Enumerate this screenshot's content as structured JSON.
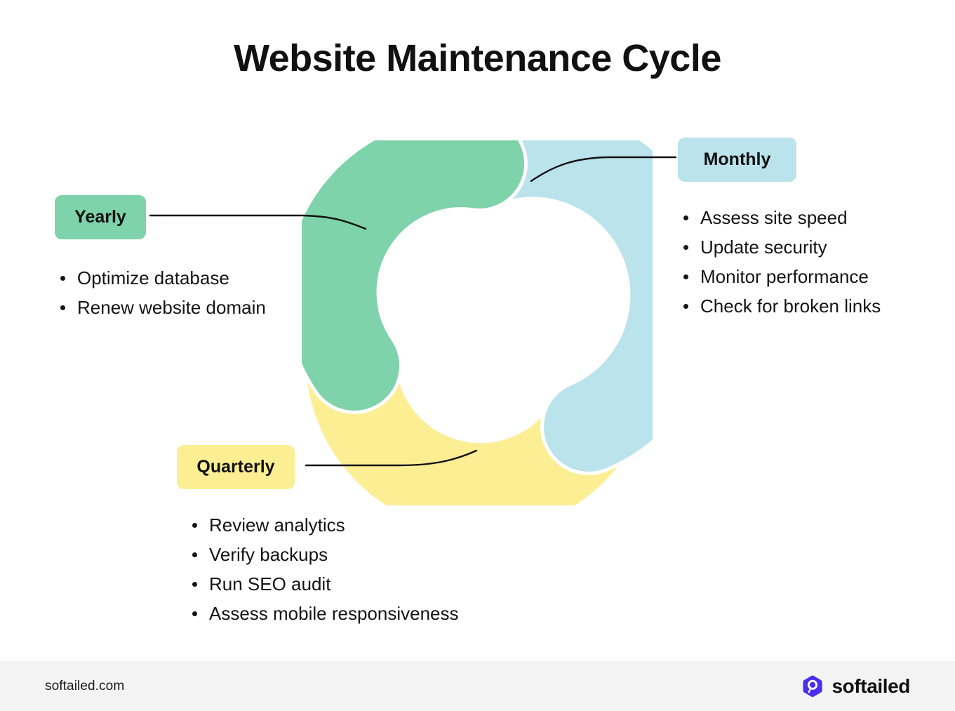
{
  "page": {
    "title": "Website Maintenance Cycle",
    "background": "#FFFFFF"
  },
  "colors": {
    "monthly": "#BBE3EC",
    "yearly": "#7ED3AA",
    "quarterly": "#FCEE93",
    "text": "#141414",
    "connector": "#111111",
    "footer_bg": "#F3F3F3",
    "brand_purple": "#4B2EF0"
  },
  "chart_data": {
    "type": "pie",
    "variant": "donut",
    "title": "Website Maintenance Cycle",
    "legend_position": "callout-labels",
    "grid": false,
    "categories": [
      "Monthly",
      "Quarterly",
      "Yearly"
    ],
    "values": [
      33.34,
      33.33,
      33.33
    ],
    "slice_colors": [
      "#BBE3EC",
      "#FCEE93",
      "#7ED3AA"
    ],
    "segments": [
      {
        "label": "Monthly",
        "color": "#BBE3EC",
        "start_angle_deg": 0,
        "end_angle_deg": 120,
        "value": 33.34
      },
      {
        "label": "Quarterly",
        "color": "#FCEE93",
        "start_angle_deg": 120,
        "end_angle_deg": 240,
        "value": 33.33
      },
      {
        "label": "Yearly",
        "color": "#7ED3AA",
        "start_angle_deg": 240,
        "end_angle_deg": 360,
        "value": 33.33
      }
    ]
  },
  "sections": {
    "yearly": {
      "label": "Yearly",
      "color": "#7ED3AA",
      "items": [
        "Optimize database",
        "Renew website domain"
      ]
    },
    "monthly": {
      "label": "Monthly",
      "color": "#BBE3EC",
      "items": [
        "Assess site speed",
        "Update security",
        "Monitor performance",
        "Check for broken links"
      ]
    },
    "quarterly": {
      "label": "Quarterly",
      "color": "#FCEE93",
      "items": [
        "Review analytics",
        "Verify backups",
        "Run SEO audit",
        "Assess mobile responsiveness"
      ]
    }
  },
  "footer": {
    "url": "softailed.com",
    "brand_name": "softailed",
    "brand_icon": "softailed-hexagon-logo-icon"
  }
}
